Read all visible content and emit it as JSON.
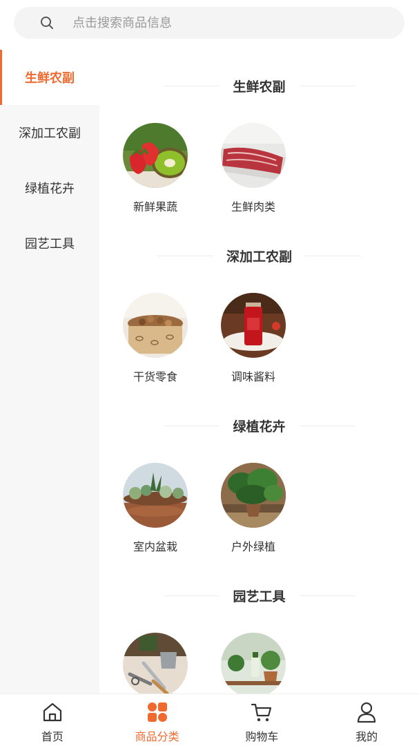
{
  "colors": {
    "accent": "#ee6a2f",
    "sidebar_bg": "#f7f7f7",
    "search_bg": "#f4f4f4",
    "text": "#333333"
  },
  "search": {
    "placeholder": "点击搜索商品信息",
    "icon": "search-icon"
  },
  "sidebar": {
    "items": [
      {
        "label": "生鲜农副",
        "active": true
      },
      {
        "label": "深加工农副",
        "active": false
      },
      {
        "label": "绿植花卉",
        "active": false
      },
      {
        "label": "园艺工具",
        "active": false
      }
    ]
  },
  "sections": [
    {
      "title": "生鲜农副",
      "items": [
        {
          "label": "新鲜果蔬",
          "image": "strawberry-kiwi-image"
        },
        {
          "label": "生鲜肉类",
          "image": "raw-meat-image"
        }
      ]
    },
    {
      "title": "深加工农副",
      "items": [
        {
          "label": "干货零食",
          "image": "nuts-box-image"
        },
        {
          "label": "调味酱料",
          "image": "sauce-bottle-image"
        }
      ]
    },
    {
      "title": "绿植花卉",
      "items": [
        {
          "label": "室内盆栽",
          "image": "succulent-pot-image"
        },
        {
          "label": "户外绿植",
          "image": "monstera-plant-image"
        }
      ]
    },
    {
      "title": "园艺工具",
      "items": [
        {
          "label": "",
          "image": "garden-tools-image"
        },
        {
          "label": "",
          "image": "plant-shelf-image"
        }
      ]
    }
  ],
  "tabbar": {
    "items": [
      {
        "label": "首页",
        "icon": "home-icon",
        "active": false
      },
      {
        "label": "商品分类",
        "icon": "category-grid-icon",
        "active": true
      },
      {
        "label": "购物车",
        "icon": "cart-icon",
        "active": false
      },
      {
        "label": "我的",
        "icon": "user-icon",
        "active": false
      }
    ]
  }
}
